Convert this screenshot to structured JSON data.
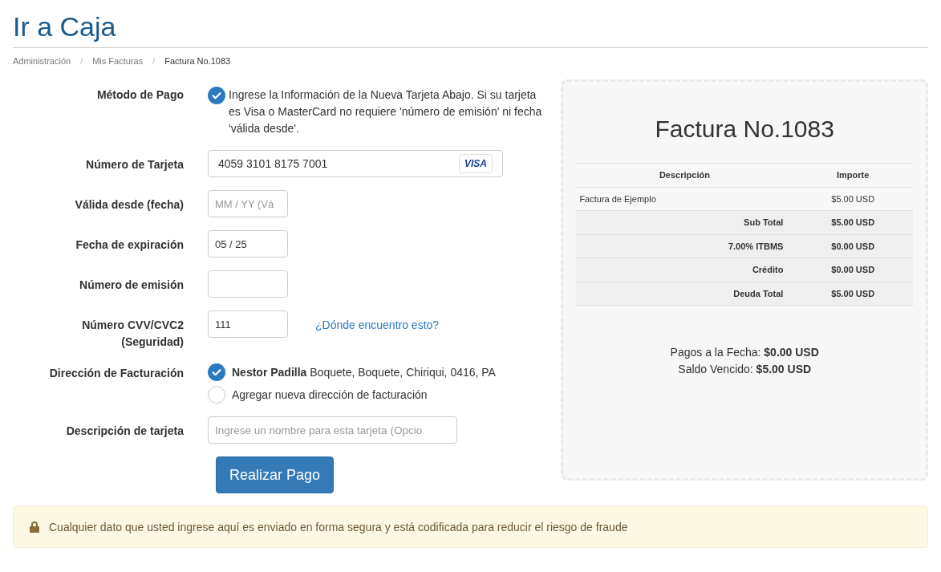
{
  "page_title": "Ir a Caja",
  "breadcrumb": [
    {
      "label": "Administración",
      "selected": false
    },
    {
      "label": "Mis Facturas",
      "selected": false
    },
    {
      "label": "Factura No.1083",
      "selected": true
    }
  ],
  "breadcrumb_separator": "/",
  "form": {
    "payment_method": {
      "label": "Método de Pago",
      "checked": true,
      "text": "Ingrese la Información de la Nueva Tarjeta Abajo. Si su tarjeta es Visa o MasterCard no requiere 'número de emisión' ni fecha 'válida desde'."
    },
    "fields": [
      {
        "kind": "card",
        "label": "Número de Tarjeta",
        "value": "4059 3101 8175 7001",
        "card_brand": "VISA"
      },
      {
        "kind": "short",
        "label": "Válida desde (fecha)",
        "placeholder": "MM / YY (Vá"
      },
      {
        "kind": "short",
        "label": "Fecha de expiración",
        "value": "05 / 25"
      },
      {
        "kind": "short",
        "label": "Número de emisión"
      },
      {
        "kind": "cvv",
        "label": "Número CVV/CVC2 (Seguridad)",
        "value": "111",
        "link": "¿Dónde encuentro esto?"
      }
    ],
    "billing": {
      "label": "Dirección de Facturación",
      "options": [
        {
          "text": "**Nestor Padilla** Boquete, Boquete, Chiriqui, 0416, PA",
          "selected": true
        },
        {
          "text": "Agregar nueva dirección de facturación",
          "selected": false
        }
      ]
    },
    "card_description": {
      "label": "Descripción de tarjeta",
      "placeholder": "Ingrese un nombre para esta tarjeta (Opcio"
    },
    "submit": "Realizar Pago"
  },
  "invoice": {
    "title": "Factura No.1083",
    "columns": [
      "Descripción",
      "Importe"
    ],
    "rows": [
      {
        "kind": "item",
        "description": "Factura de Ejemplo",
        "amount": "$5.00 USD"
      },
      {
        "kind": "summary",
        "description": "Sub Total",
        "amount": "$5.00 USD"
      },
      {
        "kind": "summary",
        "description": "7.00% ITBMS",
        "amount": "$0.00 USD"
      },
      {
        "kind": "summary",
        "description": "Crédito",
        "amount": "$0.00 USD"
      },
      {
        "kind": "summary",
        "description": "Deuda Total",
        "amount": "$5.00 USD"
      }
    ],
    "payments": "Pagos a la Fecha: **$0.00 USD**",
    "balance": "Saldo Vencido: **$5.00 USD**"
  },
  "notice": "Cualquier dato que usted ingrese aquí es enviado en forma segura y está codificada para reducir el riesgo de fraude"
}
